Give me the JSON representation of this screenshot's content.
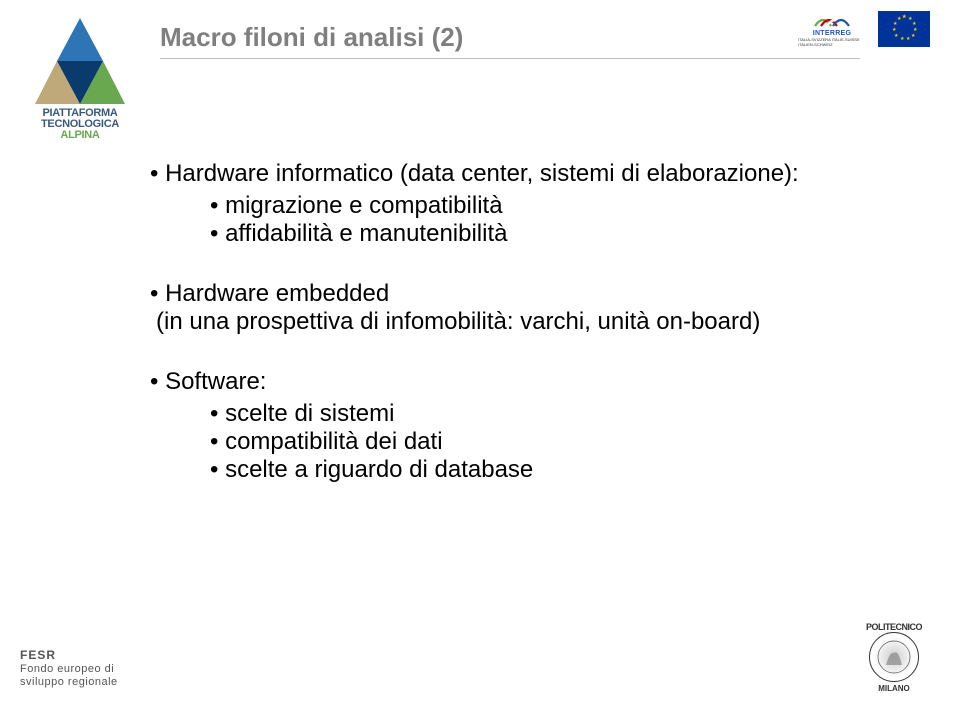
{
  "title": "Macro filoni di analisi (2)",
  "logos": {
    "pta": {
      "line1": "PIATTAFORMA",
      "line2": "TECNOLOGICA",
      "line3": "ALPINA"
    },
    "interreg": {
      "label": "INTERREG",
      "sub": "ITALIA-SVIZZERA ITALIE-SUISSE ITALIEN-SCHWEIZ"
    }
  },
  "bullets": [
    {
      "text": "Hardware informatico (data center, sistemi di elaborazione):",
      "sub": [
        "migrazione e compatibilità",
        "affidabilità e manutenibilità"
      ]
    },
    {
      "text": "Hardware embedded",
      "sub_inline": "(in una prospettiva di infomobilità: varchi, unità on-board)"
    },
    {
      "text": "Software:",
      "sub": [
        "scelte di sistemi",
        "compatibilità dei dati",
        "scelte a riguardo di database"
      ]
    }
  ],
  "footer": {
    "line1": "FESR",
    "line2": "Fondo europeo di",
    "line3": "sviluppo regionale"
  },
  "poli": {
    "top": "POLITECNICO",
    "bottom": "MILANO"
  }
}
